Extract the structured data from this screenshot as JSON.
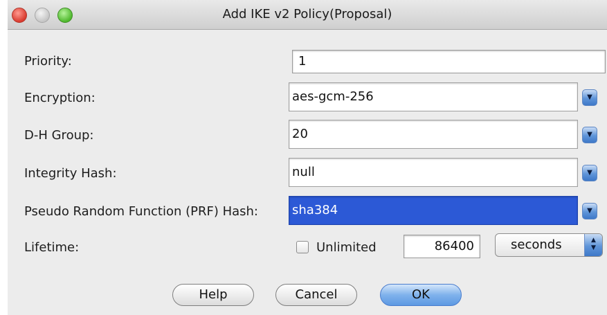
{
  "window": {
    "title": "Add IKE v2 Policy(Proposal)"
  },
  "form": {
    "priority": {
      "label": "Priority:",
      "value": "1"
    },
    "encryption": {
      "label": "Encryption:",
      "value": "aes-gcm-256"
    },
    "dh_group": {
      "label": "D-H Group:",
      "value": "20"
    },
    "integrity_hash": {
      "label": "Integrity Hash:",
      "value": "null"
    },
    "prf_hash": {
      "label": "Pseudo Random Function (PRF) Hash:",
      "value": "sha384"
    },
    "lifetime": {
      "label": "Lifetime:",
      "unlimited_label": "Unlimited",
      "unlimited_checked": false,
      "value": "86400",
      "unit": "seconds"
    }
  },
  "buttons": {
    "help": "Help",
    "cancel": "Cancel",
    "ok": "OK"
  },
  "colors": {
    "selection": "#2c59d6",
    "default_button": "#7fb2ec"
  }
}
